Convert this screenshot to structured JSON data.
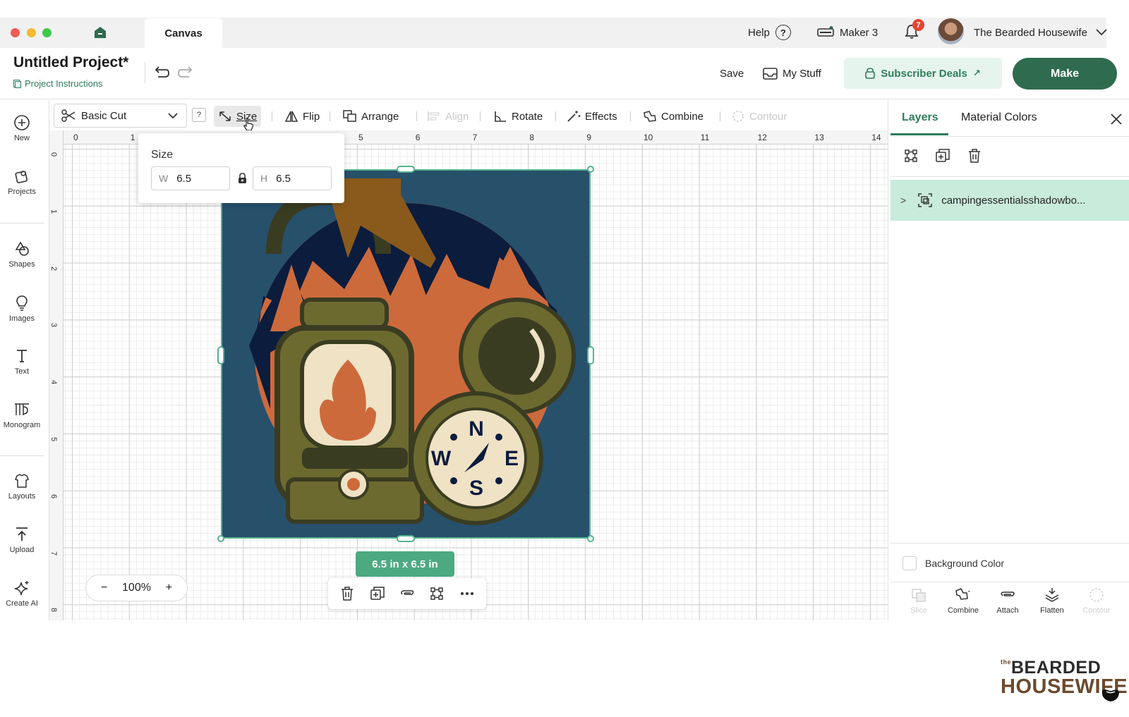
{
  "window": {
    "tab": "Canvas"
  },
  "topbar": {
    "help": "Help",
    "help_glyph": "?",
    "machine": "Maker 3",
    "notifications_count": "7",
    "account_name": "The Bearded Housewife"
  },
  "header": {
    "project_title": "Untitled Project*",
    "project_instructions": "Project Instructions",
    "save": "Save",
    "my_stuff": "My Stuff",
    "subscriber_deals": "Subscriber Deals",
    "subscriber_arrow": "↗",
    "make": "Make"
  },
  "left_rail": {
    "items": [
      {
        "label": "New",
        "icon": "plus-circle-icon"
      },
      {
        "label": "Projects",
        "icon": "projects-icon"
      },
      {
        "label": "Shapes",
        "icon": "shapes-icon"
      },
      {
        "label": "Images",
        "icon": "lightbulb-icon"
      },
      {
        "label": "Text",
        "icon": "text-icon"
      },
      {
        "label": "Monogram",
        "icon": "monogram-icon"
      },
      {
        "label": "Layouts",
        "icon": "layouts-icon"
      },
      {
        "label": "Upload",
        "icon": "upload-icon"
      },
      {
        "label": "Create AI",
        "icon": "sparkle-icon"
      }
    ]
  },
  "toolbar": {
    "operation": "Basic Cut",
    "operation_help": "?",
    "size": "Size",
    "flip": "Flip",
    "arrange": "Arrange",
    "align": "Align",
    "rotate": "Rotate",
    "effects": "Effects",
    "combine": "Combine",
    "contour": "Contour"
  },
  "size_popover": {
    "title": "Size",
    "width_label": "W",
    "width_value": "6.5",
    "height_label": "H",
    "height_value": "6.5"
  },
  "ruler": {
    "top": [
      "0",
      "1",
      "2",
      "3",
      "4",
      "5",
      "6",
      "7",
      "8",
      "9",
      "10",
      "11",
      "12",
      "13",
      "14"
    ],
    "left": [
      "0",
      "1",
      "2",
      "3",
      "4",
      "5",
      "6",
      "7",
      "8"
    ]
  },
  "selection": {
    "dimensions": "6.5 in x 6.5 in"
  },
  "zoom": {
    "minus": "−",
    "value": "100%",
    "plus": "+"
  },
  "right_panel": {
    "tabs": [
      "Layers",
      "Material Colors"
    ],
    "layer_name": "campingessentialsshadowbo...",
    "background_color": "Background Color",
    "bottom_tools": [
      {
        "label": "Slice",
        "enabled": false
      },
      {
        "label": "Combine",
        "enabled": true
      },
      {
        "label": "Attach",
        "enabled": true
      },
      {
        "label": "Flatten",
        "enabled": true
      },
      {
        "label": "Contour",
        "enabled": false
      }
    ]
  },
  "watermark": {
    "the": "the",
    "line1": "BEARDED",
    "line2": "HOUSEWIFE"
  },
  "colors": {
    "accent_green": "#2f6b4f",
    "selection_green": "#54b38e",
    "layer_highlight": "#c9ebdc",
    "art_background": "#27506b",
    "art_sky": "#0c1c3d",
    "art_orange": "#cd6a3c",
    "art_olive": "#6c6a2f",
    "arrow_brown": "#8a5a1c"
  }
}
